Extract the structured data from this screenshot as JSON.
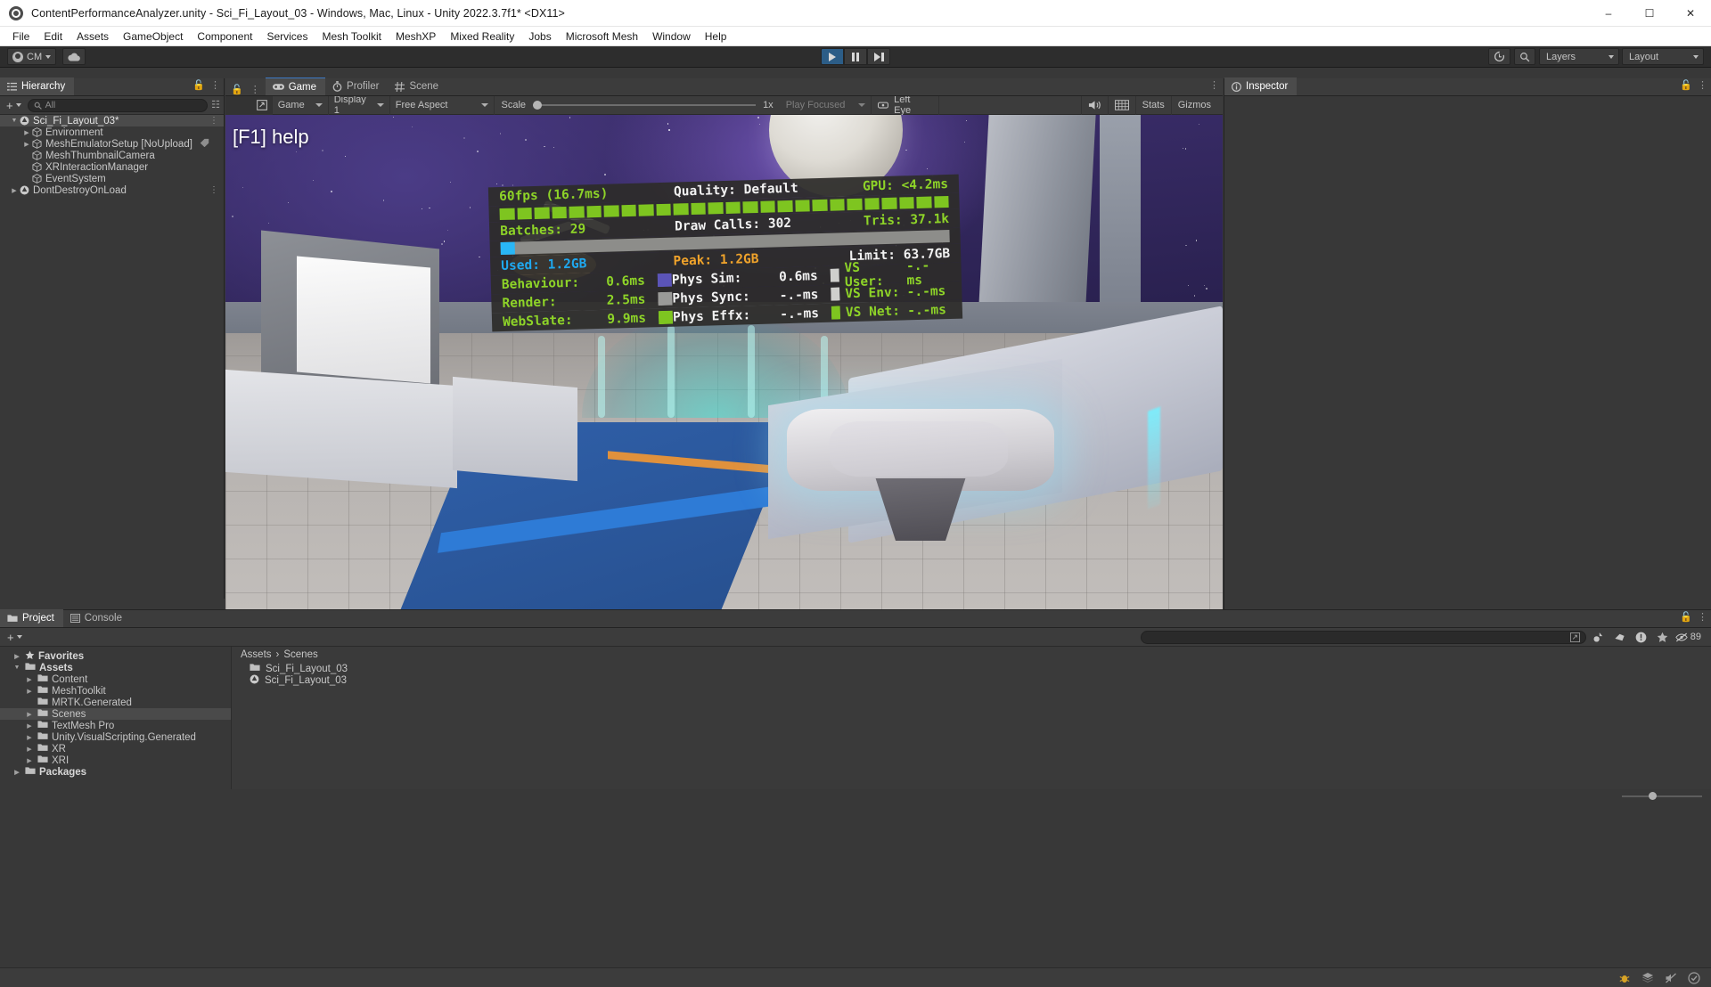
{
  "window": {
    "title": "ContentPerformanceAnalyzer.unity - Sci_Fi_Layout_03 - Windows, Mac, Linux - Unity 2022.3.7f1* <DX11>",
    "minimize": "–",
    "maximize": "☐",
    "close": "✕"
  },
  "menubar": {
    "items": [
      "File",
      "Edit",
      "Assets",
      "GameObject",
      "Component",
      "Services",
      "Mesh Toolkit",
      "MeshXP",
      "Mixed Reality",
      "Jobs",
      "Microsoft Mesh",
      "Window",
      "Help"
    ]
  },
  "toolbar": {
    "account_label": "CM",
    "cloud_icon": "cloud-icon",
    "play_icon": "play-icon",
    "pause_icon": "pause-icon",
    "step_icon": "step-icon",
    "history_icon": "undo-history-icon",
    "search_icon": "search-icon",
    "layers_label": "Layers",
    "layout_label": "Layout"
  },
  "hierarchy": {
    "tab_label": "Hierarchy",
    "tab_icon": "hierarchy-icon",
    "add_label": "+",
    "search_placeholder": "All",
    "search_icon": "search-icon",
    "items": [
      {
        "label": "Sci_Fi_Layout_03*",
        "indent": 0,
        "arrow": "▼",
        "icon": "unity-scene-icon",
        "selected": true,
        "menu": "⋮"
      },
      {
        "label": "Environment",
        "indent": 1,
        "arrow": "▶",
        "icon": "gameobject-cube-icon",
        "selected": false,
        "menu": ""
      },
      {
        "label": "MeshEmulatorSetup [NoUpload]",
        "indent": 1,
        "arrow": "▶",
        "icon": "gameobject-cube-icon",
        "selected": false,
        "menu": "",
        "badge": "prefab-tag-icon"
      },
      {
        "label": "MeshThumbnailCamera",
        "indent": 1,
        "arrow": "",
        "icon": "gameobject-cube-icon",
        "selected": false,
        "menu": ""
      },
      {
        "label": "XRInteractionManager",
        "indent": 1,
        "arrow": "",
        "icon": "gameobject-cube-icon",
        "selected": false,
        "menu": ""
      },
      {
        "label": "EventSystem",
        "indent": 1,
        "arrow": "",
        "icon": "gameobject-cube-icon",
        "selected": false,
        "menu": ""
      },
      {
        "label": "DontDestroyOnLoad",
        "indent": 0,
        "arrow": "▶",
        "icon": "unity-scene-icon",
        "selected": false,
        "menu": "⋮"
      }
    ]
  },
  "gameview": {
    "tabs": [
      {
        "label": "Game",
        "icon": "gamepad-icon",
        "active": true
      },
      {
        "label": "Profiler",
        "icon": "stopwatch-icon",
        "active": false
      },
      {
        "label": "Scene",
        "icon": "grid-hash-icon",
        "active": false
      }
    ],
    "lock_icon": "lock-icon",
    "menu_icon": "kebab-menu-icon",
    "toolbar": {
      "maximize_icon": "maximize-on-play-icon",
      "view_label": "Game",
      "display_label": "Display 1",
      "aspect_label": "Free Aspect",
      "scale_label": "Scale",
      "scale_value": "1x",
      "play_focus_label": "Play Focused",
      "vr_icon": "vr-headset-icon",
      "eye_label": "Left Eye",
      "mute_icon": "audio-icon",
      "grid_icon": "frame-debugger-icon",
      "stats_label": "Stats",
      "gizmos_label": "Gizmos"
    },
    "overlay_help": "[F1] help"
  },
  "hud": {
    "fps": "60fps (16.7ms)",
    "quality": "Quality: Default",
    "gpu": "GPU: <4.2ms",
    "batches": "Batches: 29",
    "draw_calls": "Draw Calls: 302",
    "tris": "Tris: 37.1k",
    "mem_used": "Used: 1.2GB",
    "mem_peak": "Peak: 1.2GB",
    "mem_limit": "Limit: 63.7GB",
    "rows": [
      {
        "l_key": "Behaviour:",
        "l_val": "0.6ms",
        "m_key": "Phys Sim:",
        "m_val": "0.6ms",
        "r_key": "VS User:",
        "r_val": "-.-ms"
      },
      {
        "l_key": "Render:",
        "l_val": "2.5ms",
        "m_key": "Phys Sync:",
        "m_val": "-.-ms",
        "r_key": "VS Env:",
        "r_val": "-.-ms"
      },
      {
        "l_key": "WebSlate:",
        "l_val": "9.9ms",
        "m_key": "Phys Effx:",
        "m_val": "-.-ms",
        "r_key": "VS Net:",
        "r_val": "-.-ms"
      }
    ],
    "frame_tick_count": 26,
    "colors": {
      "green": "#8ed428",
      "white": "#f2f2f2",
      "cyan": "#1fa8ef",
      "orange": "#f0a32b",
      "bar_green": "#7ec520",
      "mem_fill": "#29b6f6",
      "mem_track": "#8d8d8a"
    }
  },
  "inspector": {
    "tab_label": "Inspector",
    "tab_icon": "info-icon",
    "lock_icon": "lock-icon",
    "menu_icon": "kebab-menu-icon"
  },
  "project": {
    "tabs": [
      {
        "label": "Project",
        "icon": "folder-icon",
        "active": true
      },
      {
        "label": "Console",
        "icon": "console-icon",
        "active": false
      }
    ],
    "add_label": "+",
    "search_placeholder": "",
    "search_icon": "search-icon",
    "tree": [
      {
        "label": "Favorites",
        "indent": 0,
        "arrow": "▶",
        "icon": "star-icon",
        "bold": true,
        "selected": false
      },
      {
        "label": "Assets",
        "indent": 0,
        "arrow": "▼",
        "icon": "open-folder-icon",
        "bold": true,
        "selected": false
      },
      {
        "label": "Content",
        "indent": 1,
        "arrow": "▶",
        "icon": "folder-icon",
        "bold": false,
        "selected": false
      },
      {
        "label": "MeshToolkit",
        "indent": 1,
        "arrow": "▶",
        "icon": "folder-icon",
        "bold": false,
        "selected": false
      },
      {
        "label": "MRTK.Generated",
        "indent": 1,
        "arrow": "",
        "icon": "folder-icon",
        "bold": false,
        "selected": false
      },
      {
        "label": "Scenes",
        "indent": 1,
        "arrow": "▶",
        "icon": "folder-icon",
        "bold": false,
        "selected": true
      },
      {
        "label": "TextMesh Pro",
        "indent": 1,
        "arrow": "▶",
        "icon": "folder-icon",
        "bold": false,
        "selected": false
      },
      {
        "label": "Unity.VisualScripting.Generated",
        "indent": 1,
        "arrow": "▶",
        "icon": "folder-icon",
        "bold": false,
        "selected": false
      },
      {
        "label": "XR",
        "indent": 1,
        "arrow": "▶",
        "icon": "folder-icon",
        "bold": false,
        "selected": false
      },
      {
        "label": "XRI",
        "indent": 1,
        "arrow": "▶",
        "icon": "folder-icon",
        "bold": false,
        "selected": false
      },
      {
        "label": "Packages",
        "indent": 0,
        "arrow": "▶",
        "icon": "folder-icon",
        "bold": true,
        "selected": false
      }
    ],
    "breadcrumb": [
      "Assets",
      "Scenes"
    ],
    "breadcrumb_sep": "›",
    "assets": [
      {
        "label": "Sci_Fi_Layout_03",
        "icon": "folder-icon"
      },
      {
        "label": "Sci_Fi_Layout_03",
        "icon": "unity-scene-icon"
      }
    ],
    "icons": {
      "save_search": "save-search-icon",
      "preview": "preview-icon",
      "label": "label-icon",
      "warning": "warning-icon",
      "favorite": "star-icon",
      "hidden_count_icon": "hidden-eye-icon",
      "hidden_count": "89"
    }
  },
  "statusbar": {
    "icons": [
      "bug-icon",
      "stack-icon",
      "mute-icon",
      "check-circle-icon"
    ]
  }
}
